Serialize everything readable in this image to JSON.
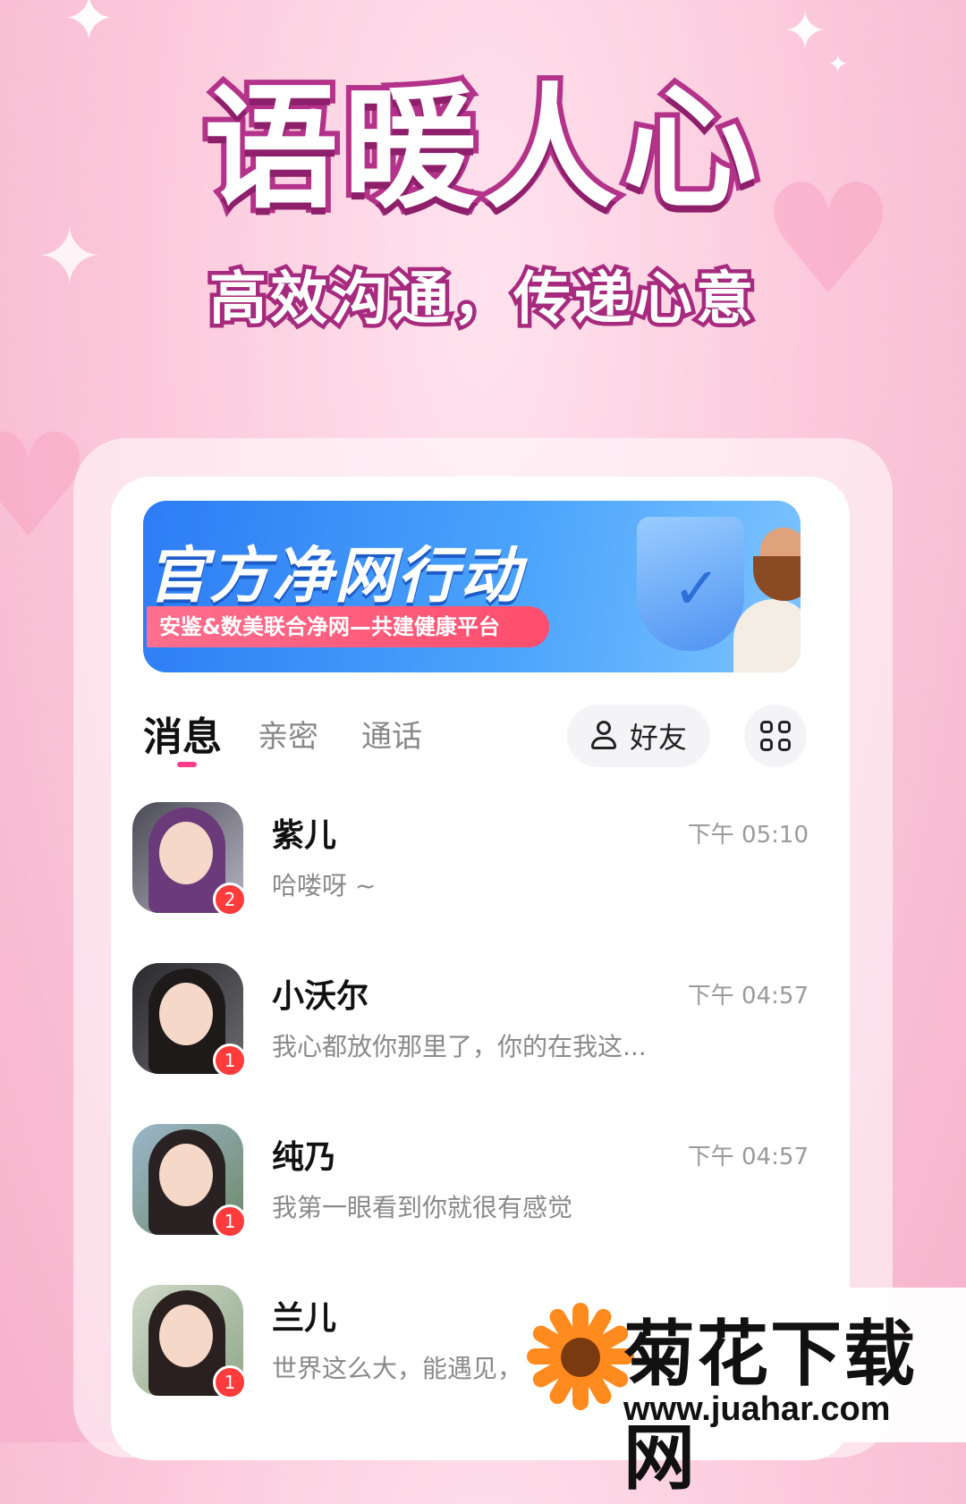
{
  "hero": {
    "title": "语暖人心",
    "subtitle": "高效沟通，传递心意"
  },
  "banner": {
    "title": "官方净网行动",
    "ribbon": "安鉴&数美联合净网—共建健康平台"
  },
  "tabs": [
    {
      "label": "消息",
      "active": true
    },
    {
      "label": "亲密",
      "active": false
    },
    {
      "label": "通话",
      "active": false
    }
  ],
  "toolbar": {
    "friends_label": "好友"
  },
  "messages": [
    {
      "name": "紫儿",
      "preview": "哈喽呀 ~",
      "time": "下午 05:10",
      "unread": "2"
    },
    {
      "name": "小沃尔",
      "preview": "我心都放你那里了，你的在我这...",
      "time": "下午 04:57",
      "unread": "1"
    },
    {
      "name": "纯乃",
      "preview": "我第一眼看到你就很有感觉",
      "time": "下午 04:57",
      "unread": "1"
    },
    {
      "name": "兰儿",
      "preview": "世界这么大，能遇见，",
      "time": "",
      "unread": "1"
    }
  ],
  "watermark": {
    "text": "菊花下载网",
    "url": "www.juahar.com"
  },
  "colors": {
    "accent": "#ff3d8b",
    "title_stroke": "#b4338a",
    "badge": "#ff3b3b"
  }
}
